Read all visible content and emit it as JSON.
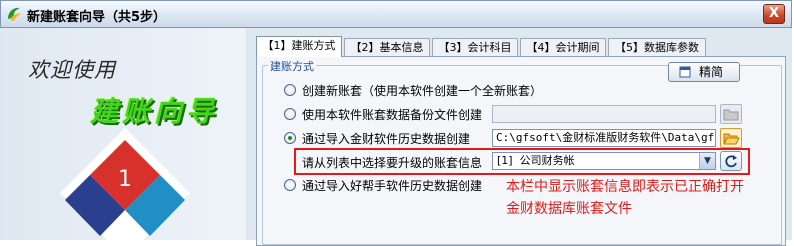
{
  "window": {
    "title": "新建账套向导（共5步）",
    "close_label": "X"
  },
  "welcome_panel": {
    "welcome_text": "欢迎使用",
    "wizard_title": "建账向导",
    "step_number": "1"
  },
  "tabs": [
    {
      "label": "【1】建账方式",
      "active": true
    },
    {
      "label": "【2】基本信息",
      "active": false
    },
    {
      "label": "【3】会计科目",
      "active": false
    },
    {
      "label": "【4】会计期间",
      "active": false
    },
    {
      "label": "【5】数据库参数",
      "active": false
    }
  ],
  "group": {
    "label": "建账方式",
    "detail_button": "精简"
  },
  "options": [
    {
      "label": "创建新账套（使用本软件创建一个全新账套）",
      "checked": false
    },
    {
      "label": "使用本软件账套数据备份文件创建",
      "checked": false,
      "path": ""
    },
    {
      "label": "通过导入金财软件历史数据创建",
      "checked": true,
      "path": "C:\\gfsoft\\金财标准版财务软件\\Data\\gf:"
    },
    {
      "label": "通过导入好帮手软件历史数据创建",
      "checked": false
    }
  ],
  "select_account": {
    "label": "请从列表中选择要升级的账套信息",
    "value": "[1]  公司财务帐"
  },
  "annotation": {
    "line1": "本栏中显示账套信息即表示已正确打开",
    "line2": "金财数据库账套文件"
  },
  "colors": {
    "accent_red": "#e01b1b",
    "group_label_blue": "#1a4fa3",
    "wizard_green": "#44d61c"
  }
}
